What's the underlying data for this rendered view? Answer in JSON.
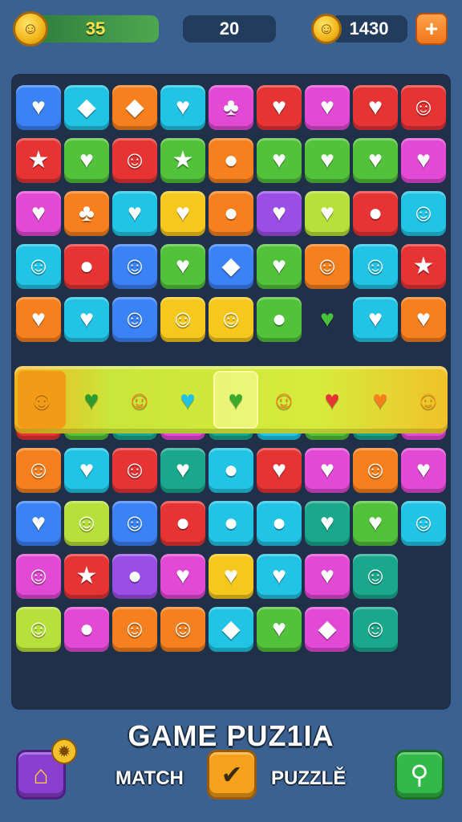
{
  "hud": {
    "coins_value": "35",
    "moves_value": "20",
    "score_value": "1430",
    "plus_label": "+",
    "coin_icon": "coin-icon",
    "score_coin_icon": "smiley-coin-icon"
  },
  "board": {
    "colors": {
      "blue": "#3b82f6",
      "cyan": "#22c4e6",
      "orange": "#f7801e",
      "red": "#e63434",
      "green": "#52c23a",
      "pink": "#e24ad6",
      "purple": "#9b4ee6",
      "yellow": "#f6c81e",
      "teal": "#1aa88c",
      "lime": "#b8e03a",
      "lightgreen": "#7ad64a"
    },
    "glyphs": {
      "heart": "♥",
      "star": "★",
      "face": "☺",
      "apple": "●",
      "leaf": "♣",
      "blob": "◆"
    },
    "rows": [
      [
        "blue:heart",
        "cyan:blob",
        "orange:blob",
        "cyan:heart",
        "pink:leaf",
        "red:heart",
        "pink:heart",
        "red:heart",
        "red:face"
      ],
      [
        "red:star",
        "green:heart",
        "red:face",
        "green:star",
        "orange:apple",
        "green:heart",
        "green:heart",
        "green:heart",
        "pink:heart"
      ],
      [
        "pink:heart",
        "orange:leaf",
        "cyan:heart",
        "yellow:heart",
        "orange:apple",
        "purple:heart",
        "lime:heart",
        "red:apple",
        "cyan:face"
      ],
      [
        "cyan:face",
        "red:apple",
        "blue:face",
        "green:heart",
        "blue:blob",
        "green:heart",
        "orange:face",
        "cyan:face",
        "red:star"
      ],
      [
        "orange:heart",
        "cyan:heart",
        "blue:face",
        "yellow:face",
        "yellow:face",
        "green:apple",
        "empty:heart",
        "cyan:heart",
        "orange:heart"
      ],
      [
        "red:face",
        "green:face",
        "teal:face",
        "pink:face",
        "teal:apple",
        "cyan:apple",
        "green:heart",
        "teal:heart",
        "pink:face"
      ],
      [
        "orange:face",
        "cyan:heart",
        "red:face",
        "teal:heart",
        "cyan:apple",
        "red:heart",
        "pink:heart",
        "orange:face",
        "pink:heart"
      ],
      [
        "blue:heart",
        "lime:face",
        "blue:face",
        "red:apple",
        "cyan:apple",
        "cyan:apple",
        "teal:heart",
        "green:heart",
        "cyan:face"
      ],
      [
        "pink:face",
        "red:star",
        "purple:apple",
        "pink:heart",
        "yellow:heart",
        "cyan:heart",
        "pink:heart",
        "teal:face",
        "none"
      ],
      [
        "lime:face",
        "pink:apple",
        "orange:face",
        "orange:face",
        "cyan:blob",
        "green:heart",
        "pink:blob",
        "teal:face",
        "none"
      ]
    ],
    "strip": [
      "face",
      "heart",
      "face",
      "heart",
      "heart",
      "face",
      "heart",
      "heart",
      "face"
    ],
    "strip_colors": [
      "#f6a21c",
      "#2e9a2e",
      "#f7801e",
      "#22c4e6",
      "#3aaa2a",
      "#f7801e",
      "#e63434",
      "#f7801e",
      "#f6a21c"
    ]
  },
  "footer": {
    "title": "GAME PUZ1IA",
    "match_label": "MATCH",
    "puzzle_label": "PUZZLĚ",
    "home_icon": "home-icon",
    "check_icon": "check-icon",
    "search_icon": "search-icon",
    "gear_icon": "gear-icon"
  }
}
